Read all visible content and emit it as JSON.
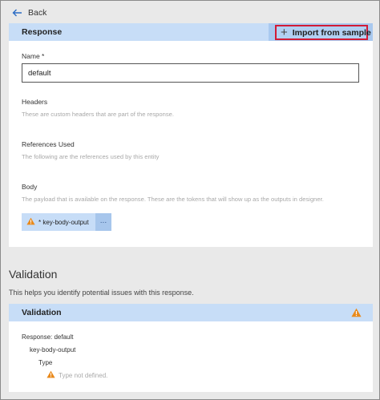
{
  "nav": {
    "back_label": "Back"
  },
  "response_section": {
    "header_title": "Response",
    "import_button_label": "Import from sample",
    "name_label": "Name *",
    "name_value": "default",
    "headers_label": "Headers",
    "headers_desc": "These are custom headers that are part of the response.",
    "references_label": "References Used",
    "references_desc": "The following are the references used by this entity",
    "body_label": "Body",
    "body_desc": "The payload that is available on the response. These are the tokens that will show up as the outputs in designer.",
    "body_token_label": "* key-body-output",
    "body_token_more": "···"
  },
  "validation": {
    "title": "Validation",
    "description": "This helps you identify potential issues with this response.",
    "header_title": "Validation",
    "tree": {
      "root": "Response: default",
      "child": "key-body-output",
      "property": "Type",
      "message": "Type not defined."
    }
  },
  "colors": {
    "header_blue": "#c7ddf7",
    "import_highlight_border": "#d21b36",
    "warning_orange": "#e98a1c",
    "back_arrow_blue": "#2b6cc4"
  },
  "icons": {
    "back": "arrow-left-icon",
    "import": "plus-icon",
    "warning": "warning-triangle-icon",
    "more": "ellipsis-icon"
  }
}
